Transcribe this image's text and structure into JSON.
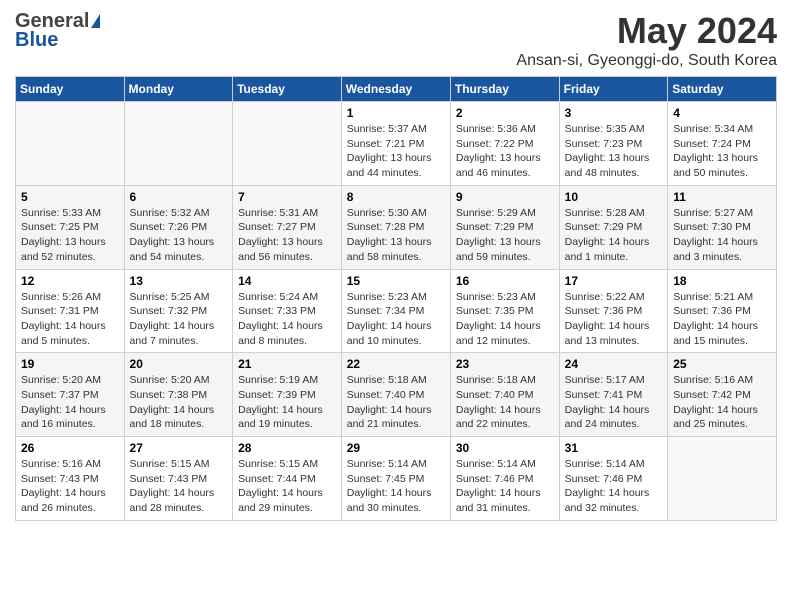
{
  "logo": {
    "general": "General",
    "blue": "Blue"
  },
  "title": "May 2024",
  "subtitle": "Ansan-si, Gyeonggi-do, South Korea",
  "days_of_week": [
    "Sunday",
    "Monday",
    "Tuesday",
    "Wednesday",
    "Thursday",
    "Friday",
    "Saturday"
  ],
  "weeks": [
    [
      {
        "day": "",
        "info": ""
      },
      {
        "day": "",
        "info": ""
      },
      {
        "day": "",
        "info": ""
      },
      {
        "day": "1",
        "info": "Sunrise: 5:37 AM\nSunset: 7:21 PM\nDaylight: 13 hours\nand 44 minutes."
      },
      {
        "day": "2",
        "info": "Sunrise: 5:36 AM\nSunset: 7:22 PM\nDaylight: 13 hours\nand 46 minutes."
      },
      {
        "day": "3",
        "info": "Sunrise: 5:35 AM\nSunset: 7:23 PM\nDaylight: 13 hours\nand 48 minutes."
      },
      {
        "day": "4",
        "info": "Sunrise: 5:34 AM\nSunset: 7:24 PM\nDaylight: 13 hours\nand 50 minutes."
      }
    ],
    [
      {
        "day": "5",
        "info": "Sunrise: 5:33 AM\nSunset: 7:25 PM\nDaylight: 13 hours\nand 52 minutes."
      },
      {
        "day": "6",
        "info": "Sunrise: 5:32 AM\nSunset: 7:26 PM\nDaylight: 13 hours\nand 54 minutes."
      },
      {
        "day": "7",
        "info": "Sunrise: 5:31 AM\nSunset: 7:27 PM\nDaylight: 13 hours\nand 56 minutes."
      },
      {
        "day": "8",
        "info": "Sunrise: 5:30 AM\nSunset: 7:28 PM\nDaylight: 13 hours\nand 58 minutes."
      },
      {
        "day": "9",
        "info": "Sunrise: 5:29 AM\nSunset: 7:29 PM\nDaylight: 13 hours\nand 59 minutes."
      },
      {
        "day": "10",
        "info": "Sunrise: 5:28 AM\nSunset: 7:29 PM\nDaylight: 14 hours\nand 1 minute."
      },
      {
        "day": "11",
        "info": "Sunrise: 5:27 AM\nSunset: 7:30 PM\nDaylight: 14 hours\nand 3 minutes."
      }
    ],
    [
      {
        "day": "12",
        "info": "Sunrise: 5:26 AM\nSunset: 7:31 PM\nDaylight: 14 hours\nand 5 minutes."
      },
      {
        "day": "13",
        "info": "Sunrise: 5:25 AM\nSunset: 7:32 PM\nDaylight: 14 hours\nand 7 minutes."
      },
      {
        "day": "14",
        "info": "Sunrise: 5:24 AM\nSunset: 7:33 PM\nDaylight: 14 hours\nand 8 minutes."
      },
      {
        "day": "15",
        "info": "Sunrise: 5:23 AM\nSunset: 7:34 PM\nDaylight: 14 hours\nand 10 minutes."
      },
      {
        "day": "16",
        "info": "Sunrise: 5:23 AM\nSunset: 7:35 PM\nDaylight: 14 hours\nand 12 minutes."
      },
      {
        "day": "17",
        "info": "Sunrise: 5:22 AM\nSunset: 7:36 PM\nDaylight: 14 hours\nand 13 minutes."
      },
      {
        "day": "18",
        "info": "Sunrise: 5:21 AM\nSunset: 7:36 PM\nDaylight: 14 hours\nand 15 minutes."
      }
    ],
    [
      {
        "day": "19",
        "info": "Sunrise: 5:20 AM\nSunset: 7:37 PM\nDaylight: 14 hours\nand 16 minutes."
      },
      {
        "day": "20",
        "info": "Sunrise: 5:20 AM\nSunset: 7:38 PM\nDaylight: 14 hours\nand 18 minutes."
      },
      {
        "day": "21",
        "info": "Sunrise: 5:19 AM\nSunset: 7:39 PM\nDaylight: 14 hours\nand 19 minutes."
      },
      {
        "day": "22",
        "info": "Sunrise: 5:18 AM\nSunset: 7:40 PM\nDaylight: 14 hours\nand 21 minutes."
      },
      {
        "day": "23",
        "info": "Sunrise: 5:18 AM\nSunset: 7:40 PM\nDaylight: 14 hours\nand 22 minutes."
      },
      {
        "day": "24",
        "info": "Sunrise: 5:17 AM\nSunset: 7:41 PM\nDaylight: 14 hours\nand 24 minutes."
      },
      {
        "day": "25",
        "info": "Sunrise: 5:16 AM\nSunset: 7:42 PM\nDaylight: 14 hours\nand 25 minutes."
      }
    ],
    [
      {
        "day": "26",
        "info": "Sunrise: 5:16 AM\nSunset: 7:43 PM\nDaylight: 14 hours\nand 26 minutes."
      },
      {
        "day": "27",
        "info": "Sunrise: 5:15 AM\nSunset: 7:43 PM\nDaylight: 14 hours\nand 28 minutes."
      },
      {
        "day": "28",
        "info": "Sunrise: 5:15 AM\nSunset: 7:44 PM\nDaylight: 14 hours\nand 29 minutes."
      },
      {
        "day": "29",
        "info": "Sunrise: 5:14 AM\nSunset: 7:45 PM\nDaylight: 14 hours\nand 30 minutes."
      },
      {
        "day": "30",
        "info": "Sunrise: 5:14 AM\nSunset: 7:46 PM\nDaylight: 14 hours\nand 31 minutes."
      },
      {
        "day": "31",
        "info": "Sunrise: 5:14 AM\nSunset: 7:46 PM\nDaylight: 14 hours\nand 32 minutes."
      },
      {
        "day": "",
        "info": ""
      }
    ]
  ]
}
